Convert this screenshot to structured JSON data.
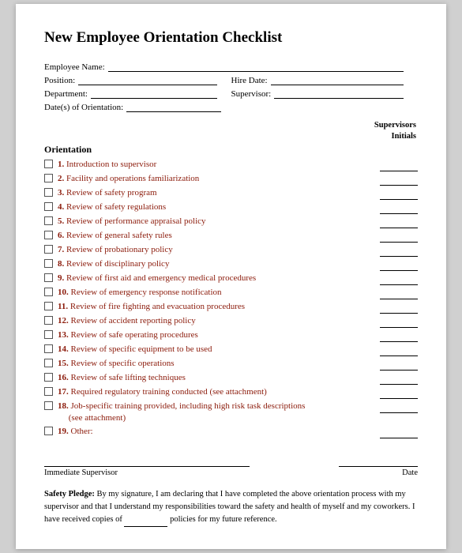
{
  "title": "New Employee Orientation Checklist",
  "fields": {
    "employee_name_label": "Employee Name:",
    "position_label": "Position:",
    "hire_date_label": "Hire Date:",
    "department_label": "Department:",
    "supervisor_label": "Supervisor:",
    "dates_label": "Date(s) of Orientation:"
  },
  "supervisors_initials": {
    "line1": "Supervisors",
    "line2": "Initials"
  },
  "orientation_label": "Orientation",
  "items": [
    {
      "num": "1.",
      "text": "Introduction to supervisor"
    },
    {
      "num": "2.",
      "text": "Facility and operations familiarization"
    },
    {
      "num": "3.",
      "text": "Review of safety program"
    },
    {
      "num": "4.",
      "text": "Review of safety regulations"
    },
    {
      "num": "5.",
      "text": "Review of performance appraisal policy"
    },
    {
      "num": "6.",
      "text": "Review of general safety rules"
    },
    {
      "num": "7.",
      "text": "Review of probationary policy"
    },
    {
      "num": "8.",
      "text": "Review of disciplinary policy"
    },
    {
      "num": "9.",
      "text": "Review of first aid and emergency medical procedures"
    },
    {
      "num": "10.",
      "text": "Review of emergency response notification"
    },
    {
      "num": "11.",
      "text": "Review of fire fighting and evacuation procedures"
    },
    {
      "num": "12.",
      "text": "Review of accident reporting policy"
    },
    {
      "num": "13.",
      "text": "Review of safe operating procedures"
    },
    {
      "num": "14.",
      "text": "Review of specific equipment to be used"
    },
    {
      "num": "15.",
      "text": "Review of specific operations"
    },
    {
      "num": "16.",
      "text": "Review of safe lifting techniques"
    },
    {
      "num": "17.",
      "text": "Required regulatory training conducted (see attachment)"
    },
    {
      "num": "18.",
      "text": "Job-specific training provided, including high risk task descriptions\n(see attachment)"
    },
    {
      "num": "19.",
      "text": "Other: "
    }
  ],
  "signature": {
    "supervisor_label": "Immediate Supervisor",
    "date_label": "Date"
  },
  "safety_pledge": {
    "label": "Safety Pledge:",
    "text": "By my signature, I am declaring that I have completed the above orientation process with my supervisor and that I understand my responsibilities toward the safety and health of myself and my coworkers. I have received copies of",
    "blank": "",
    "text2": "policies for my future reference."
  }
}
